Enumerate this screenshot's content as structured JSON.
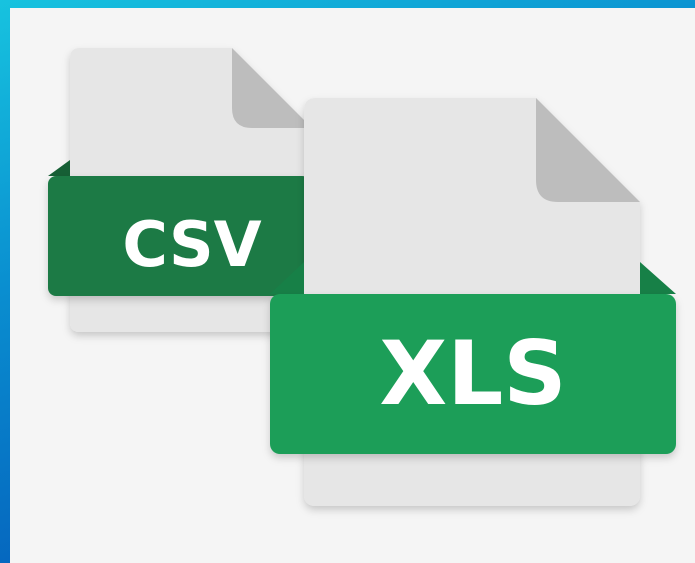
{
  "files": {
    "csv": {
      "label": "CSV",
      "band_color": "#1e7a45",
      "band_shadow": "#165f35"
    },
    "xls": {
      "label": "XLS",
      "band_color": "#1f9e58",
      "band_shadow": "#178047"
    }
  },
  "colors": {
    "paper": "#e6e6e6",
    "paper_fold": "#bdbdbd",
    "background": "#f5f5f5"
  }
}
